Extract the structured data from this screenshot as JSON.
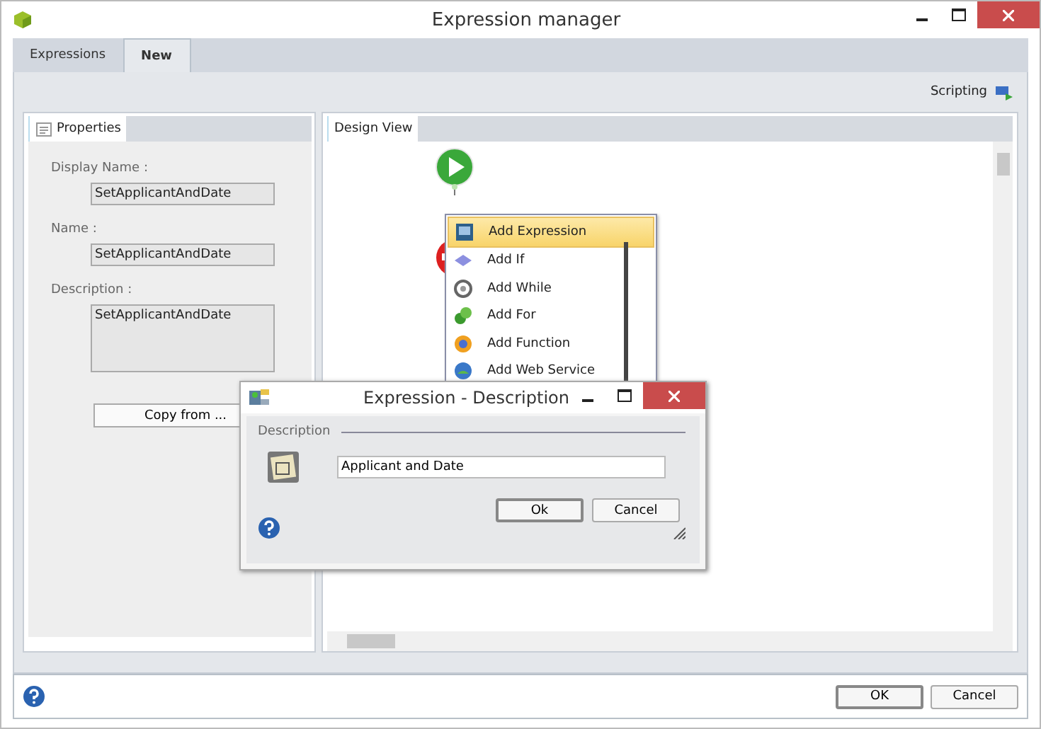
{
  "window": {
    "title": "Expression manager"
  },
  "tabs": [
    {
      "label": "Expressions",
      "selected": false
    },
    {
      "label": "New",
      "selected": true
    }
  ],
  "toolbar": {
    "scripting": "Scripting"
  },
  "properties": {
    "tab": "Properties",
    "fields": [
      {
        "label": "Display Name :",
        "value": "SetApplicantAndDate",
        "kind": "line"
      },
      {
        "label": "Name :",
        "value": "SetApplicantAndDate",
        "kind": "line"
      },
      {
        "label": "Description :",
        "value": "SetApplicantAndDate",
        "kind": "area"
      }
    ],
    "copy_button": "Copy from ..."
  },
  "design_view": {
    "tab": "Design View"
  },
  "context_menu": [
    {
      "label": "Add Expression",
      "kind": "expression",
      "selected": true
    },
    {
      "label": "Add If",
      "kind": "if",
      "selected": false
    },
    {
      "label": "Add While",
      "kind": "while",
      "selected": false
    },
    {
      "label": "Add For",
      "kind": "for",
      "selected": false
    },
    {
      "label": "Add Function",
      "kind": "function",
      "selected": false
    },
    {
      "label": "Add Web Service",
      "kind": "webservice",
      "selected": false
    }
  ],
  "dialog": {
    "title": "Expression - Description",
    "group": "Description",
    "value": "Applicant and Date",
    "buttons": [
      "Ok",
      "Cancel"
    ]
  },
  "footer": {
    "buttons": [
      "OK",
      "Cancel"
    ]
  }
}
